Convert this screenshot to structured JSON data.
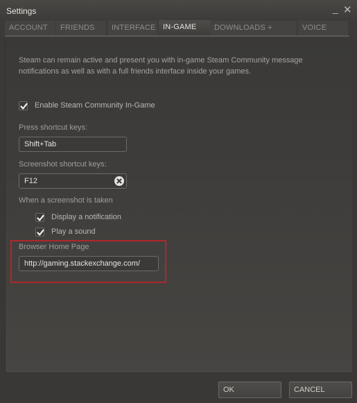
{
  "window": {
    "title": "Settings",
    "minimize_glyph": "_",
    "close_glyph": "✕"
  },
  "tabs": [
    {
      "label": "ACCOUNT",
      "active": false
    },
    {
      "label": "FRIENDS",
      "active": false
    },
    {
      "label": "INTERFACE",
      "active": false
    },
    {
      "label": "IN-GAME",
      "active": true
    },
    {
      "label": "DOWNLOADS + CLOUD",
      "active": false
    },
    {
      "label": "VOICE",
      "active": false
    }
  ],
  "ingame": {
    "description": "Steam can remain active and present you with in-game Steam Community message notifications as well as with a full friends interface inside your games.",
    "enable_community": {
      "label": "Enable Steam Community In-Game",
      "checked": true
    },
    "shortcut": {
      "label": "Press shortcut keys:",
      "value": "Shift+Tab"
    },
    "screenshot_shortcut": {
      "label": "Screenshot shortcut keys:",
      "value": "F12",
      "clear_icon": "clear-icon"
    },
    "screenshot_taken_label": "When a screenshot is taken",
    "display_notification": {
      "label": "Display a notification",
      "checked": true
    },
    "play_sound": {
      "label": "Play a sound",
      "checked": true
    },
    "browser_home": {
      "label": "Browser Home Page",
      "value": "http://gaming.stackexchange.com/"
    },
    "highlight_color": "#b0262a"
  },
  "footer": {
    "ok_label": "OK",
    "cancel_label": "CANCEL"
  }
}
